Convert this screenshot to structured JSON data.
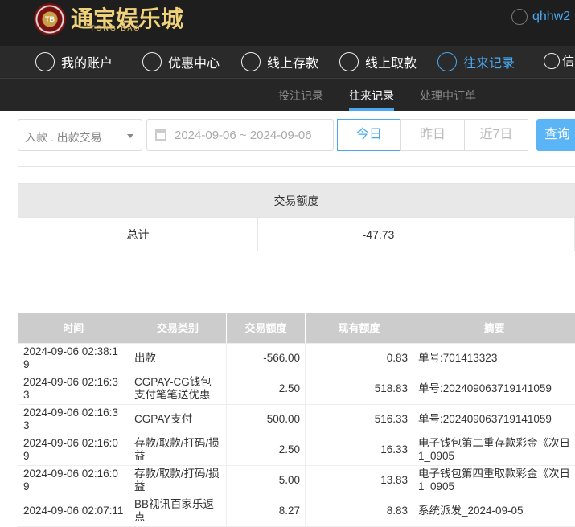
{
  "header": {
    "logo_text": "通宝娱乐城",
    "logo_sub": "TONG BAO",
    "logo_chip": "TB",
    "username": "qhhw2"
  },
  "nav": [
    {
      "label": "我的账户",
      "icon": "user-icon"
    },
    {
      "label": "优惠中心",
      "icon": "gift-icon"
    },
    {
      "label": "线上存款",
      "icon": "deposit-icon"
    },
    {
      "label": "线上取款",
      "icon": "withdraw-icon"
    },
    {
      "label": "往来记录",
      "icon": "records-icon",
      "active": true
    },
    {
      "label": "信",
      "icon": "bell-icon"
    }
  ],
  "subnav": [
    {
      "label": "投注记录"
    },
    {
      "label": "往来记录",
      "active": true
    },
    {
      "label": "处理中订单"
    }
  ],
  "filters": {
    "type": "入款 . 出款交易",
    "date_range": "2024-09-06 ~ 2024-09-06",
    "today": "今日",
    "yesterday": "昨日",
    "last7": "近7日",
    "query": "查询"
  },
  "summary": {
    "header": "交易额度",
    "label": "总计",
    "value": "-47.73"
  },
  "table": {
    "columns": [
      "时间",
      "交易类别",
      "交易额度",
      "现有额度",
      "摘要"
    ],
    "rows": [
      [
        "2024-09-06 02:38:19",
        "出款",
        "-566.00",
        "0.83",
        "单号:701413323"
      ],
      [
        "2024-09-06 02:16:33",
        "CGPAY-CG钱包支付笔笔送优惠",
        "2.50",
        "518.83",
        "单号:202409063719141059"
      ],
      [
        "2024-09-06 02:16:33",
        "CGPAY支付",
        "500.00",
        "516.33",
        "单号:202409063719141059"
      ],
      [
        "2024-09-06 02:16:09",
        "存款/取款/打码/损益",
        "2.50",
        "16.33",
        "电子钱包第二重存款彩金《次日1_0905"
      ],
      [
        "2024-09-06 02:16:09",
        "存款/取款/打码/损益",
        "5.00",
        "13.83",
        "电子钱包第四重取款彩金《次日1_0905"
      ],
      [
        "2024-09-06 02:07:11",
        "BB视讯百家乐返点",
        "8.27",
        "8.83",
        "系统派发_2024-09-05"
      ]
    ]
  },
  "colors": {
    "accent": "#4aa8f0",
    "topbar": "#1e1e1e"
  }
}
